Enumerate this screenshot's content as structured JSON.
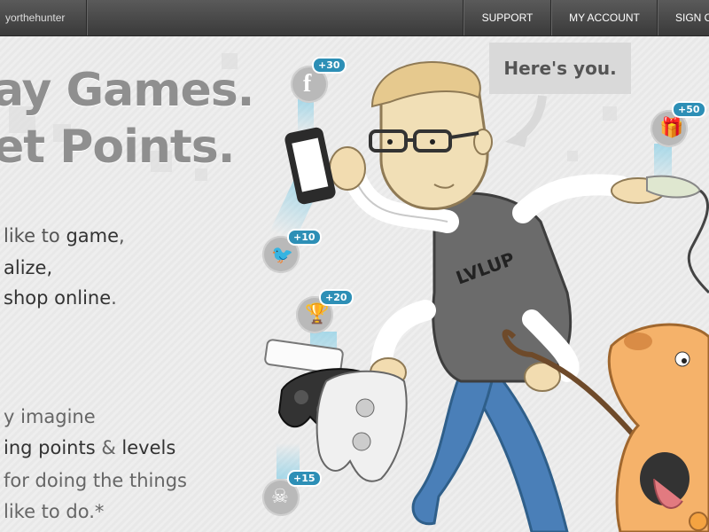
{
  "topbar": {
    "username": "yorthehunter",
    "nav": [
      {
        "label": "SUPPORT"
      },
      {
        "label": "MY ACCOUNT"
      },
      {
        "label": "SIGN O"
      }
    ]
  },
  "hero": {
    "headline_1": "ay Games.",
    "headline_2": "et Points.",
    "line1_pre": " like to ",
    "line1_em": "game",
    "line1_post": ",",
    "line2": "alize,",
    "line3_em": " shop online",
    "line3_post": ".",
    "line4": "y imagine",
    "line5_em1": "ing points",
    "line5_mid": " & ",
    "line5_em2": "levels",
    "line6": " for doing the things",
    "line7": " like to do.*"
  },
  "bubble": {
    "text": "Here's you."
  },
  "badges": [
    {
      "icon": "facebook-icon",
      "points": "+30"
    },
    {
      "icon": "twitter-icon",
      "points": "+10"
    },
    {
      "icon": "trophy-icon",
      "points": "+20"
    },
    {
      "icon": "skull-icon",
      "points": "+15"
    },
    {
      "icon": "gift-icon",
      "points": "+50"
    }
  ],
  "shirt_logo": "LVLUP",
  "colors": {
    "accent": "#2d8fb6",
    "topbar": "#444444",
    "headline": "#8f8f8f"
  }
}
